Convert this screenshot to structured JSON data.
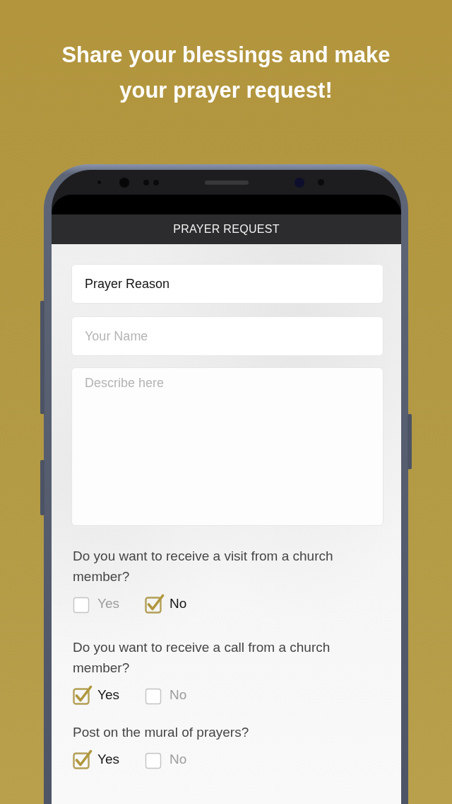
{
  "headline": "Share your blessings and make your prayer request!",
  "app_bar": {
    "title": "PRAYER REQUEST"
  },
  "form": {
    "fields": [
      {
        "kind": "input",
        "value": "Prayer Reason"
      },
      {
        "kind": "input",
        "placeholder": "Your Name"
      },
      {
        "kind": "textarea",
        "placeholder": "Describe here"
      }
    ],
    "questions": [
      {
        "text": "Do you want to receive a visit from a church member?",
        "options": [
          {
            "label": "Yes",
            "checked": false
          },
          {
            "label": "No",
            "checked": true
          }
        ]
      },
      {
        "text": "Do you want to receive a call from a church member?",
        "options": [
          {
            "label": "Yes",
            "checked": true
          },
          {
            "label": "No",
            "checked": false
          }
        ]
      },
      {
        "text": "Post on the mural of prayers?",
        "options": [
          {
            "label": "Yes",
            "checked": true
          },
          {
            "label": "No",
            "checked": false
          }
        ]
      }
    ]
  }
}
